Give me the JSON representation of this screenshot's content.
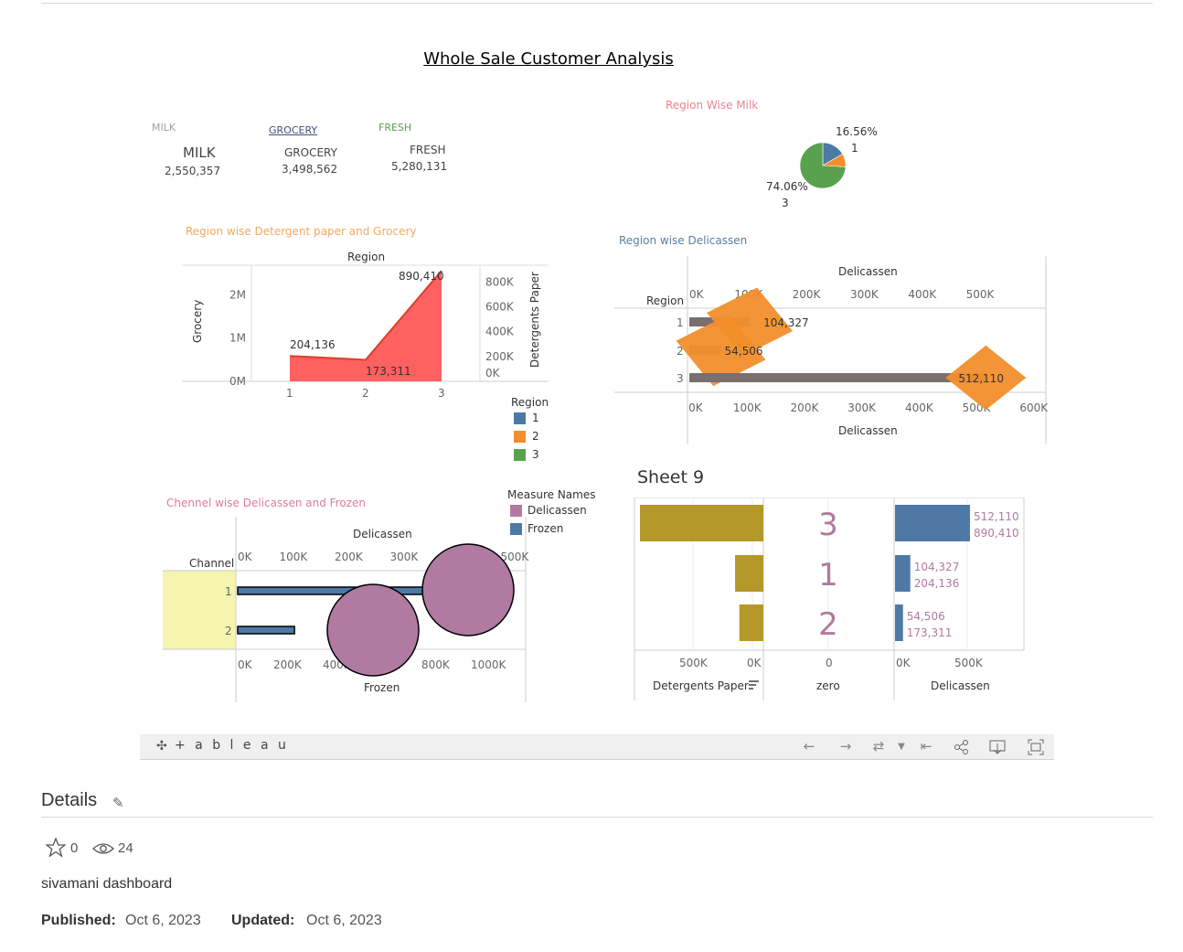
{
  "dashboard": {
    "title": "Whole Sale Customer Analysis",
    "kpis": [
      {
        "tag": "MILK",
        "tag_color": "#a0a0a0",
        "name": "MILK",
        "value": "2,550,357"
      },
      {
        "tag": "GROCERY",
        "tag_color": "#4a4a7a",
        "name": "GROCERY",
        "value": "3,498,562"
      },
      {
        "tag": "FRESH",
        "tag_color": "#59a14f",
        "name": "FRESH",
        "value": "5,280,131"
      }
    ]
  },
  "chart_data": [
    {
      "id": "region-wise-milk",
      "type": "pie",
      "title": "Region Wise Milk",
      "title_color": "#f08090",
      "slices": [
        {
          "region": "1",
          "share": 16.56,
          "color": "#4e79a7"
        },
        {
          "region": "2",
          "share": 9.38,
          "color": "#f28e2b"
        },
        {
          "region": "3",
          "share": 74.06,
          "color": "#59a14f"
        }
      ],
      "labels": [
        {
          "pct": "16.56%",
          "region": "1"
        },
        {
          "pct": "74.06%",
          "region": "3"
        }
      ]
    },
    {
      "id": "detergent-grocery",
      "type": "area",
      "title": "Region wise Detergent paper and Grocery",
      "title_color": "#f5a960",
      "xlabel": "Region",
      "ylabel_left": "Grocery",
      "ylabel_right": "Detergents Paper",
      "categories": [
        "1",
        "2",
        "3"
      ],
      "left_ticks": [
        "2M",
        "1M",
        "0M"
      ],
      "right_ticks": [
        "800K",
        "600K",
        "400K",
        "200K",
        "0K"
      ],
      "series": [
        {
          "name": "Grocery",
          "values": [
            570000,
            470000,
            2500000
          ],
          "color": "#59a14f"
        },
        {
          "name": "Detergents Paper",
          "values": [
            204136,
            173311,
            890410
          ],
          "color": "#ff6060"
        }
      ],
      "data_labels": [
        "204,136",
        "173,311",
        "890,410"
      ],
      "ylim_left": [
        0,
        2600000
      ],
      "ylim_right": [
        0,
        890410
      ]
    },
    {
      "id": "region-legend",
      "title": "Region",
      "items": [
        {
          "label": "1",
          "color": "#4e79a7"
        },
        {
          "label": "2",
          "color": "#f28e2b"
        },
        {
          "label": "3",
          "color": "#59a14f"
        }
      ]
    },
    {
      "id": "region-delicassen",
      "type": "bar",
      "title": "Region wise Delicassen",
      "title_color": "#5b7ca0",
      "row_header": "Region",
      "top_axis_label": "Delicassen",
      "bottom_axis_label": "Delicassen",
      "top_ticks": [
        "0K",
        "100K",
        "200K",
        "300K",
        "400K",
        "500K"
      ],
      "bottom_ticks": [
        "0K",
        "100K",
        "200K",
        "300K",
        "400K",
        "500K",
        "600K"
      ],
      "categories": [
        "1",
        "2",
        "3"
      ],
      "values": [
        104327,
        54506,
        512110
      ],
      "labels": [
        "104,327",
        "54,506",
        "512,110"
      ],
      "xlim": [
        0,
        600000
      ]
    },
    {
      "id": "channel-delicassen-frozen",
      "type": "bar",
      "title": "Chennel wise Delicassen and Frozen",
      "title_color": "#e07aa0",
      "row_header": "Channel",
      "top_axis_label": "Delicassen",
      "bottom_axis_label": "Frozen",
      "top_ticks": [
        "0K",
        "100K",
        "200K",
        "300K",
        "400K",
        "500K"
      ],
      "bottom_ticks": [
        "0K",
        "200K",
        "400K",
        "600K",
        "800K",
        "1000K"
      ],
      "categories": [
        "1",
        "2"
      ],
      "series": [
        {
          "name": "Frozen",
          "values": [
            760000,
            230000
          ],
          "color": "#4e79a7"
        },
        {
          "name": "Delicassen",
          "values": [
            500000,
            245000
          ],
          "color": "#b07aa1"
        }
      ],
      "legend_title": "Measure Names",
      "legend": [
        {
          "label": "Delicassen",
          "color": "#b07aa1"
        },
        {
          "label": "Frozen",
          "color": "#4e79a7"
        }
      ]
    },
    {
      "id": "sheet-9",
      "type": "bar",
      "title": "Sheet 9",
      "categories": [
        "3",
        "1",
        "2"
      ],
      "detergents_paper": [
        890410,
        204136,
        173311
      ],
      "delicassen": [
        512110,
        104327,
        54506
      ],
      "labels_top": [
        "512,110",
        "104,327",
        "54,506"
      ],
      "labels_bottom": [
        "890,410",
        "204,136",
        "173,311"
      ],
      "left_ticks": [
        "500K",
        "0K"
      ],
      "mid_ticks": [
        "0"
      ],
      "right_ticks": [
        "0K",
        "500K"
      ],
      "left_axis_label": "Detergents Paper",
      "mid_axis_label": "zero",
      "right_axis_label": "Delicassen"
    }
  ],
  "toolbar": {
    "logo": "+ a b l e a u",
    "icons": [
      "undo-icon",
      "redo-icon",
      "revert-icon",
      "dropdown-icon",
      "reset-icon",
      "share-icon",
      "download-icon",
      "fullscreen-icon"
    ]
  },
  "details": {
    "heading": "Details",
    "favorites": "0",
    "views": "24",
    "description": "sivamani dashboard",
    "published_label": "Published:",
    "published_value": "Oct 6, 2023",
    "updated_label": "Updated:",
    "updated_value": "Oct 6, 2023"
  }
}
